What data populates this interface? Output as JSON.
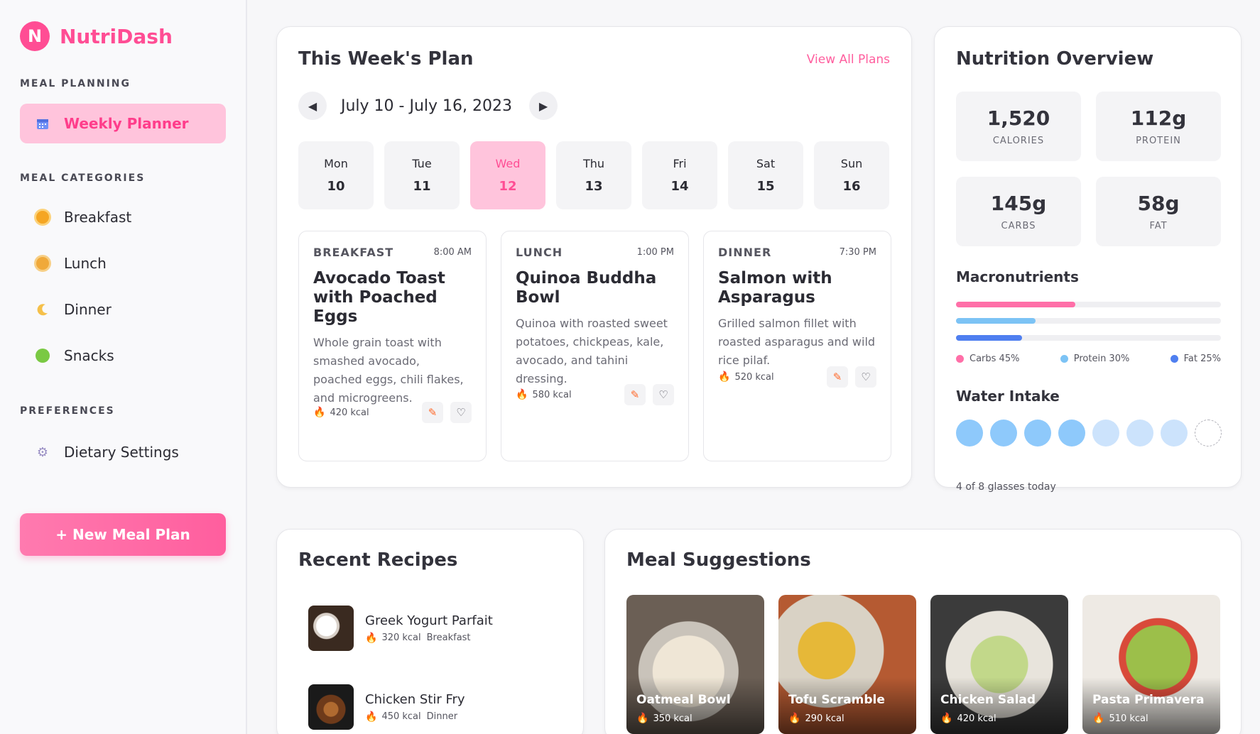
{
  "brand": {
    "letter": "N",
    "name": "NutriDash"
  },
  "sidebar": {
    "section_planning": "MEAL PLANNING",
    "planner_label": "Weekly Planner",
    "section_categories": "MEAL CATEGORIES",
    "categories": [
      "Breakfast",
      "Lunch",
      "Dinner",
      "Snacks"
    ],
    "section_preferences": "PREFERENCES",
    "dietary_label": "Dietary Settings",
    "new_plan_label": "+ New Meal Plan"
  },
  "week": {
    "title": "This Week's Plan",
    "view_all": "View All Plans",
    "range": "July 10 - July 16, 2023",
    "prev_icon": "◀",
    "next_icon": "▶",
    "days": [
      {
        "name": "Mon",
        "num": "10"
      },
      {
        "name": "Tue",
        "num": "11"
      },
      {
        "name": "Wed",
        "num": "12",
        "active": true
      },
      {
        "name": "Thu",
        "num": "13"
      },
      {
        "name": "Fri",
        "num": "14"
      },
      {
        "name": "Sat",
        "num": "15"
      },
      {
        "name": "Sun",
        "num": "16"
      }
    ],
    "meals": [
      {
        "type": "BREAKFAST",
        "time": "8:00 AM",
        "title": "Avocado Toast with Poached Eggs",
        "desc": "Whole grain toast with smashed avocado, poached eggs, chili flakes, and microgreens.",
        "kcal": "420 kcal"
      },
      {
        "type": "LUNCH",
        "time": "1:00 PM",
        "title": "Quinoa Buddha Bowl",
        "desc": "Quinoa with roasted sweet potatoes, chickpeas, kale, avocado, and tahini dressing.",
        "kcal": "580 kcal"
      },
      {
        "type": "DINNER",
        "time": "7:30 PM",
        "title": "Salmon with Asparagus",
        "desc": "Grilled salmon fillet with roasted asparagus and wild rice pilaf.",
        "kcal": "520 kcal"
      }
    ]
  },
  "nutrition": {
    "title": "Nutrition Overview",
    "stats": [
      {
        "value": "1,520",
        "label": "CALORIES"
      },
      {
        "value": "112g",
        "label": "PROTEIN"
      },
      {
        "value": "145g",
        "label": "CARBS"
      },
      {
        "value": "58g",
        "label": "FAT"
      }
    ],
    "macros_title": "Macronutrients",
    "macros": [
      {
        "name": "Carbs",
        "label": "Carbs 45%",
        "fraction": 0.45,
        "color": "#ff6fa8"
      },
      {
        "name": "Protein",
        "label": "Protein 30%",
        "fraction": 0.3,
        "color": "#7cc3f5"
      },
      {
        "name": "Fat",
        "label": "Fat 25%",
        "fraction": 0.25,
        "color": "#4f7ff0"
      }
    ],
    "water_title": "Water Intake",
    "water_glasses": [
      "full",
      "full",
      "full",
      "full",
      "half",
      "half",
      "half",
      "empty"
    ],
    "water_note": "4 of 8 glasses today"
  },
  "recent": {
    "title": "Recent Recipes",
    "items": [
      {
        "name": "Greek Yogurt Parfait",
        "kcal": "320 kcal",
        "category": "Breakfast"
      },
      {
        "name": "Chicken Stir Fry",
        "kcal": "450 kcal",
        "category": "Dinner"
      }
    ]
  },
  "suggestions": {
    "title": "Meal Suggestions",
    "items": [
      {
        "name": "Oatmeal Bowl",
        "kcal": "350 kcal"
      },
      {
        "name": "Tofu Scramble",
        "kcal": "290 kcal"
      },
      {
        "name": "Chicken Salad",
        "kcal": "420 kcal"
      },
      {
        "name": "Pasta Primavera",
        "kcal": "510 kcal"
      }
    ]
  },
  "colors": {
    "brand": "#ff4d94",
    "active_bg": "#ffc4dc"
  }
}
